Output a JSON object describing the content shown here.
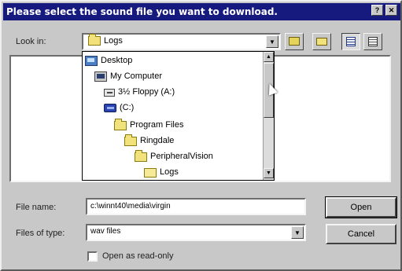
{
  "window": {
    "title": "Please select the sound file you want to download.",
    "help_button": "?",
    "close_button": "✕"
  },
  "look_in": {
    "label": "Look in:",
    "value": "Logs",
    "arrow": "▼"
  },
  "toolbar": {
    "up_folder_icon": "folder-up-icon",
    "new_folder_icon": "new-folder-icon",
    "list_view_icon": "list-view-icon",
    "details_view_icon": "details-view-icon"
  },
  "dropdown": {
    "items": [
      {
        "label": "Desktop",
        "icon": "desktop-icon"
      },
      {
        "label": "My Computer",
        "icon": "computer-icon"
      },
      {
        "label": "3½ Floppy (A:)",
        "icon": "floppy-icon"
      },
      {
        "label": "(C:)",
        "icon": "drive-icon"
      },
      {
        "label": "Program Files",
        "icon": "folder-icon"
      },
      {
        "label": "Ringdale",
        "icon": "folder-icon"
      },
      {
        "label": "PeripheralVision",
        "icon": "folder-icon"
      },
      {
        "label": "Logs",
        "icon": "folder-open-icon"
      }
    ],
    "scroll_up": "▲",
    "scroll_down": "▼"
  },
  "file_name": {
    "label": "File name:",
    "value": "c:\\winnt40\\media\\virgin"
  },
  "file_type": {
    "label": "Files of type:",
    "value": "wav files",
    "arrow": "▼"
  },
  "buttons": {
    "open": "Open",
    "cancel": "Cancel"
  },
  "read_only": {
    "label": "Open as read-only",
    "checked": false
  }
}
